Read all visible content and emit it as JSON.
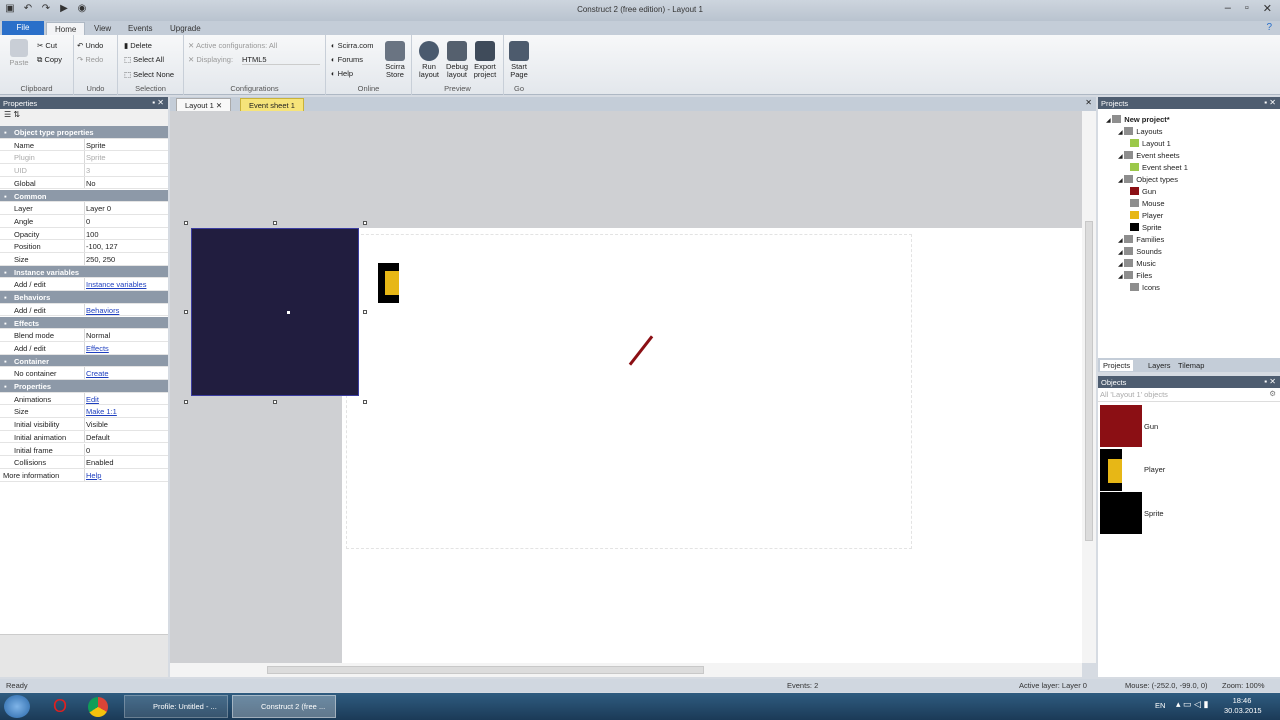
{
  "window": {
    "title": "Construct 2  (free edition) - Layout 1"
  },
  "ribbon_tabs": [
    "File",
    "Home",
    "View",
    "Events",
    "Upgrade"
  ],
  "ribbon": {
    "clipboard": {
      "paste": "Paste",
      "cut": "Cut",
      "copy": "Copy",
      "label": "Clipboard"
    },
    "undo": {
      "undo": "Undo",
      "redo": "Redo",
      "label": "Undo"
    },
    "selection": {
      "delete": "Delete",
      "select_all": "Select All",
      "select_none": "Select None",
      "label": "Selection"
    },
    "configurations": {
      "active": "Active configurations: All",
      "displaying": "Displaying:",
      "displaying_value": "HTML5",
      "label": "Configurations"
    },
    "online": {
      "scirra": "Scirra.com",
      "forums": "Forums",
      "help": "Help",
      "store": "Scirra Store",
      "label": "Online"
    },
    "preview": {
      "run": "Run layout",
      "debug": "Debug layout",
      "export": "Export project",
      "label": "Preview"
    },
    "go": {
      "start": "Start Page",
      "label": "Go"
    }
  },
  "properties": {
    "title": "Properties",
    "rows": [
      {
        "type": "cat",
        "k": "Object type properties"
      },
      {
        "k": "Name",
        "v": "Sprite"
      },
      {
        "k": "Plugin",
        "v": "Sprite",
        "disabled": true
      },
      {
        "k": "UID",
        "v": "3",
        "disabled": true
      },
      {
        "k": "Global",
        "v": "No"
      },
      {
        "type": "cat",
        "k": "Common"
      },
      {
        "k": "Layer",
        "v": "Layer 0"
      },
      {
        "k": "Angle",
        "v": "0"
      },
      {
        "k": "Opacity",
        "v": "100"
      },
      {
        "k": "Position",
        "v": "-100, 127"
      },
      {
        "k": "Size",
        "v": "250, 250"
      },
      {
        "type": "cat",
        "k": "Instance variables"
      },
      {
        "k": "Add / edit",
        "v": "Instance variables",
        "link": true
      },
      {
        "type": "cat",
        "k": "Behaviors"
      },
      {
        "k": "Add / edit",
        "v": "Behaviors",
        "link": true
      },
      {
        "type": "cat",
        "k": "Effects"
      },
      {
        "k": "Blend mode",
        "v": "Normal"
      },
      {
        "k": "Add / edit",
        "v": "Effects",
        "link": true
      },
      {
        "type": "cat",
        "k": "Container"
      },
      {
        "k": "No container",
        "v": "Create",
        "link": true
      },
      {
        "type": "cat",
        "k": "Properties"
      },
      {
        "k": "Animations",
        "v": "Edit",
        "link": true
      },
      {
        "k": "Size",
        "v": "Make 1:1",
        "link": true
      },
      {
        "k": "Initial visibility",
        "v": "Visible"
      },
      {
        "k": "Initial animation",
        "v": "Default"
      },
      {
        "k": "Initial frame",
        "v": "0"
      },
      {
        "k": "Collisions",
        "v": "Enabled"
      },
      {
        "k": "More information",
        "v": "Help",
        "link": true,
        "noindent": true
      }
    ]
  },
  "doc_tabs": [
    "Layout 1",
    "Event sheet 1"
  ],
  "projects": {
    "title": "Projects",
    "tree": [
      {
        "label": "New project*",
        "bold": true,
        "level": 0
      },
      {
        "label": "Layouts",
        "level": 1
      },
      {
        "label": "Layout 1",
        "level": 2
      },
      {
        "label": "Event sheets",
        "level": 1
      },
      {
        "label": "Event sheet 1",
        "level": 2
      },
      {
        "label": "Object types",
        "level": 1
      },
      {
        "label": "Gun",
        "level": 2,
        "swatch": "#8b0f14"
      },
      {
        "label": "Mouse",
        "level": 2
      },
      {
        "label": "Player",
        "level": 2,
        "swatch": "#e7b716"
      },
      {
        "label": "Sprite",
        "level": 2,
        "swatch": "#000000"
      },
      {
        "label": "Families",
        "level": 1
      },
      {
        "label": "Sounds",
        "level": 1
      },
      {
        "label": "Music",
        "level": 1
      },
      {
        "label": "Files",
        "level": 1
      },
      {
        "label": "Icons",
        "level": 2
      }
    ],
    "bottom_tabs": [
      "Projects",
      "Layers",
      "Tilemap"
    ]
  },
  "objects": {
    "title": "Objects",
    "filter_placeholder": "All 'Layout 1' objects",
    "items": [
      {
        "name": "Gun",
        "color": "#8b0f14"
      },
      {
        "name": "Player",
        "color": "#e7b716"
      },
      {
        "name": "Sprite",
        "color": "#000000"
      }
    ]
  },
  "status": {
    "ready": "Ready",
    "events": "Events: 2",
    "active_layer": "Active layer: Layer 0",
    "mouse": "Mouse: (-252.0, -99.0, 0)",
    "zoom": "Zoom: 100%"
  },
  "taskbar": {
    "items": [
      "Profile: Untitled - ...",
      "Construct 2  (free ..."
    ],
    "lang": "EN",
    "time": "18:46",
    "date": "30.03.2015"
  },
  "colors": {
    "sprite": "#211d3f",
    "gun": "#8b0f14",
    "player": "#e7b716"
  }
}
